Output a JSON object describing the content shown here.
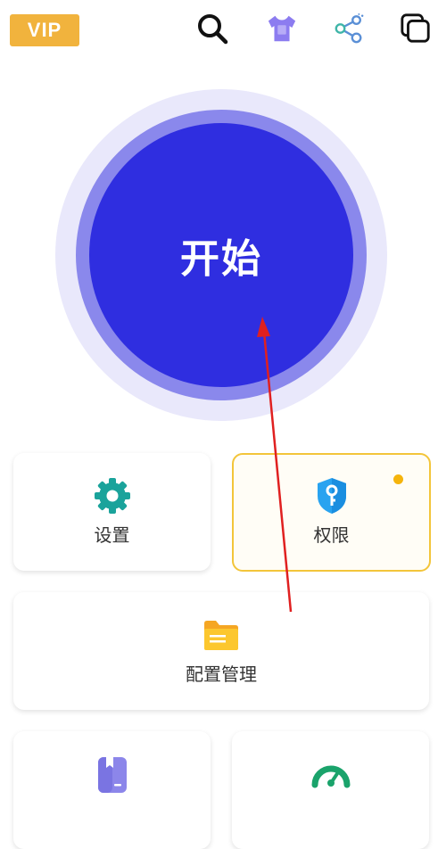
{
  "header": {
    "vip_label": "VIP",
    "icons": [
      "search-icon",
      "shirt-icon",
      "share-icon",
      "copy-icon"
    ]
  },
  "start_button": {
    "label": "开始"
  },
  "cards": {
    "settings": {
      "label": "设置",
      "icon": "gear-icon"
    },
    "permissions": {
      "label": "权限",
      "icon": "shield-key-icon",
      "has_notification_dot": true
    },
    "config": {
      "label": "配置管理",
      "icon": "folder-icon"
    },
    "bottom_left": {
      "icon": "bookmark-icon"
    },
    "bottom_right": {
      "icon": "speedometer-icon"
    }
  },
  "colors": {
    "vip": "#f1b33d",
    "primary": "#2f2ee0",
    "ring_mid": "#8a88ec",
    "ring_outer": "#e9e8fb",
    "highlight_border": "#f3c53a",
    "teal": "#1aa39b",
    "arrow": "#e02020"
  }
}
